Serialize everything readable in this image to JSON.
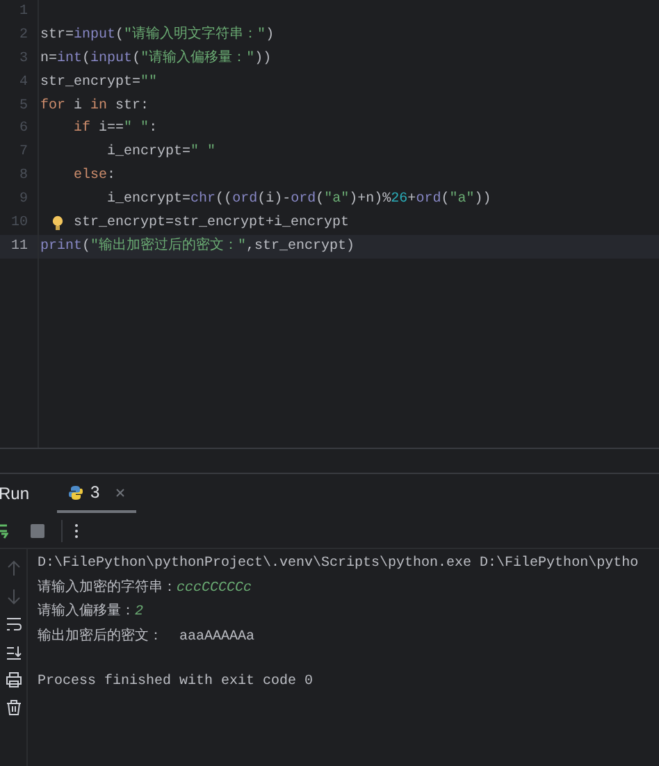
{
  "editor": {
    "lines": [
      {
        "number": "1",
        "current": false,
        "hint": false
      },
      {
        "number": "2",
        "current": false,
        "hint": false,
        "tokens": [
          {
            "kind": "plain",
            "text": "str="
          },
          {
            "kind": "builtin",
            "text": "input"
          },
          {
            "kind": "plain",
            "text": "("
          },
          {
            "kind": "string",
            "text": "\"请输入明文字符串：\""
          },
          {
            "kind": "plain",
            "text": ")"
          }
        ]
      },
      {
        "number": "3",
        "current": false,
        "hint": false,
        "tokens": [
          {
            "kind": "plain",
            "text": "n="
          },
          {
            "kind": "builtin",
            "text": "int"
          },
          {
            "kind": "plain",
            "text": "("
          },
          {
            "kind": "builtin",
            "text": "input"
          },
          {
            "kind": "plain",
            "text": "("
          },
          {
            "kind": "string",
            "text": "\"请输入偏移量：\""
          },
          {
            "kind": "plain",
            "text": "))"
          }
        ]
      },
      {
        "number": "4",
        "current": false,
        "hint": false,
        "tokens": [
          {
            "kind": "plain",
            "text": "str_encrypt="
          },
          {
            "kind": "string",
            "text": "\"\""
          }
        ]
      },
      {
        "number": "5",
        "current": false,
        "hint": false,
        "tokens": [
          {
            "kind": "keyword",
            "text": "for"
          },
          {
            "kind": "plain",
            "text": " i "
          },
          {
            "kind": "keyword",
            "text": "in"
          },
          {
            "kind": "plain",
            "text": " str:"
          }
        ]
      },
      {
        "number": "6",
        "current": false,
        "hint": false,
        "tokens": [
          {
            "kind": "keyword",
            "text": "    if"
          },
          {
            "kind": "plain",
            "text": " i=="
          },
          {
            "kind": "string",
            "text": "\" \""
          },
          {
            "kind": "plain",
            "text": ":"
          }
        ]
      },
      {
        "number": "7",
        "current": false,
        "hint": false,
        "tokens": [
          {
            "kind": "plain",
            "text": "        i_encrypt="
          },
          {
            "kind": "string",
            "text": "\" \""
          }
        ]
      },
      {
        "number": "8",
        "current": false,
        "hint": false,
        "tokens": [
          {
            "kind": "keyword",
            "text": "    else"
          },
          {
            "kind": "plain",
            "text": ":"
          }
        ]
      },
      {
        "number": "9",
        "current": false,
        "hint": false,
        "tokens": [
          {
            "kind": "plain",
            "text": "        i_encrypt="
          },
          {
            "kind": "builtin",
            "text": "chr"
          },
          {
            "kind": "plain",
            "text": "(("
          },
          {
            "kind": "builtin",
            "text": "ord"
          },
          {
            "kind": "plain",
            "text": "(i)-"
          },
          {
            "kind": "builtin",
            "text": "ord"
          },
          {
            "kind": "plain",
            "text": "("
          },
          {
            "kind": "string",
            "text": "\"a\""
          },
          {
            "kind": "plain",
            "text": ")+n)%"
          },
          {
            "kind": "number",
            "text": "26"
          },
          {
            "kind": "plain",
            "text": "+"
          },
          {
            "kind": "builtin",
            "text": "ord"
          },
          {
            "kind": "plain",
            "text": "("
          },
          {
            "kind": "string",
            "text": "\"a\""
          },
          {
            "kind": "plain",
            "text": "))"
          }
        ]
      },
      {
        "number": "10",
        "current": false,
        "hint": true,
        "tokens": [
          {
            "kind": "plain",
            "text": "    str_encrypt=str_encrypt+i_encrypt"
          }
        ]
      },
      {
        "number": "11",
        "current": true,
        "hint": false,
        "tokens": [
          {
            "kind": "builtin",
            "text": "print"
          },
          {
            "kind": "plain",
            "text": "("
          },
          {
            "kind": "string",
            "text": "\"输出加密过后的密文：\""
          },
          {
            "kind": "plain",
            "text": ",str_encrypt)"
          }
        ]
      }
    ]
  },
  "run_panel": {
    "title": "Run",
    "tabs": [
      {
        "label": "3",
        "selected": true
      }
    ],
    "console": [
      {
        "kind": "output",
        "segments": [
          {
            "kind": "output",
            "text": "D:\\FilePython\\pythonProject\\.venv\\Scripts\\python.exe D:\\FilePython\\pytho"
          }
        ]
      },
      {
        "kind": "output",
        "segments": [
          {
            "kind": "output",
            "text": "请输入加密的字符串："
          },
          {
            "kind": "input",
            "text": "cccCCCCCc"
          }
        ]
      },
      {
        "kind": "output",
        "segments": [
          {
            "kind": "output",
            "text": "请输入偏移量："
          },
          {
            "kind": "input",
            "text": "2"
          }
        ]
      },
      {
        "kind": "output",
        "segments": [
          {
            "kind": "output",
            "text": "输出加密后的密文：  aaaAAAAAa"
          }
        ]
      },
      {
        "kind": "exit",
        "segments": [
          {
            "kind": "output",
            "text": "Process finished with exit code 0"
          }
        ]
      }
    ]
  }
}
